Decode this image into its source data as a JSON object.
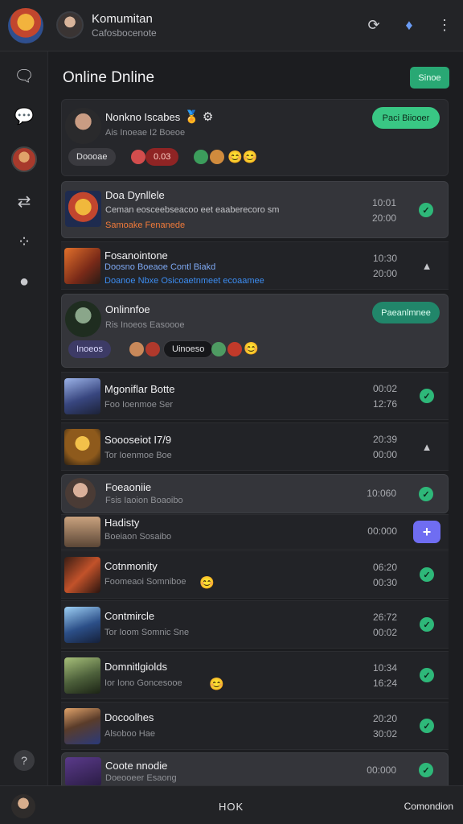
{
  "header": {
    "title": "Komumitan",
    "subtitle": "Cafosbocenote",
    "icons": [
      "logo-icon",
      "avatar",
      "refresh-icon",
      "gem-icon",
      "more-icon"
    ]
  },
  "sidebar": {
    "items": [
      "chat-bubbles-icon",
      "message-icon",
      "avatar",
      "routing-icon",
      "dots-cluster-icon",
      "comment-icon"
    ],
    "help": "?"
  },
  "main": {
    "title": "Online Dnline",
    "top_button": "Sinoe"
  },
  "rows": [
    {
      "name": "Nonkno Iscabes",
      "emoji": "🏅 ⚙",
      "sub": "Ais Inoeae I2 Boeoe",
      "button": "Paci Biiooer",
      "badges": [
        "Doooae",
        "0.03"
      ]
    },
    {
      "name": "Doa Dynllele",
      "sub1": "Ceman eosceebseacoo eet eaaberecoro sm",
      "sub2": "Samoake Fenanede",
      "time1": "10:01",
      "time2": "20:00",
      "status": "ok"
    },
    {
      "name": "Fosanointone",
      "sub1": "Doosno Boeaoe Contl Biakd",
      "sub2": "Doanoe Nbxe Osicoaetnmeet ecoaamee",
      "time1": "10:30",
      "time2": "20:00",
      "status": "tri"
    },
    {
      "name": "Onlinnfoe",
      "sub": "Ris Inoeos Easoooe",
      "button": "Paeanlmnee",
      "badges": [
        "Inoeos",
        "Uinoeso"
      ]
    },
    {
      "name": "Mgoniflar Botte",
      "sub": "Foo Ioenmoe Ser",
      "time1": "00:02",
      "time2": "12:76",
      "status": "ok"
    },
    {
      "name": "Soooseiot I7/9",
      "sub": "Tor Ioenmoe Boe",
      "time1": "20:39",
      "time2": "00:00",
      "status": "tri"
    },
    {
      "name": "Foeaoniie",
      "sub": "Fsis Iaoion Boaoibo",
      "time1": "10:060",
      "status": "ok"
    },
    {
      "name": "Hadisty",
      "sub": "Boeiaon Sosaibo",
      "time1": "00:000",
      "status": "plus"
    },
    {
      "name": "Cotnmonity",
      "sub": "Foomeaoi Somniboe",
      "time1": "06:20",
      "time2": "00:30",
      "status": "ok"
    },
    {
      "name": "Contmircle",
      "sub": "Tor Ioom Somnic Sne",
      "time1": "26:72",
      "time2": "00:02",
      "status": "ok"
    },
    {
      "name": "Domnitlgiolds",
      "sub": "Ior Iono Goncesooe",
      "time1": "10:34",
      "time2": "16:24",
      "status": "ok"
    },
    {
      "name": "Docoolhes",
      "sub": "Alsoboo Hae",
      "time1": "20:20",
      "time2": "30:02",
      "status": "ok"
    },
    {
      "name": "Coote nnodie",
      "sub": "Doeooeer Esaong",
      "time1": "00:000",
      "status": "ok"
    }
  ],
  "footer": {
    "center": "HOK",
    "right": "Comondion"
  }
}
